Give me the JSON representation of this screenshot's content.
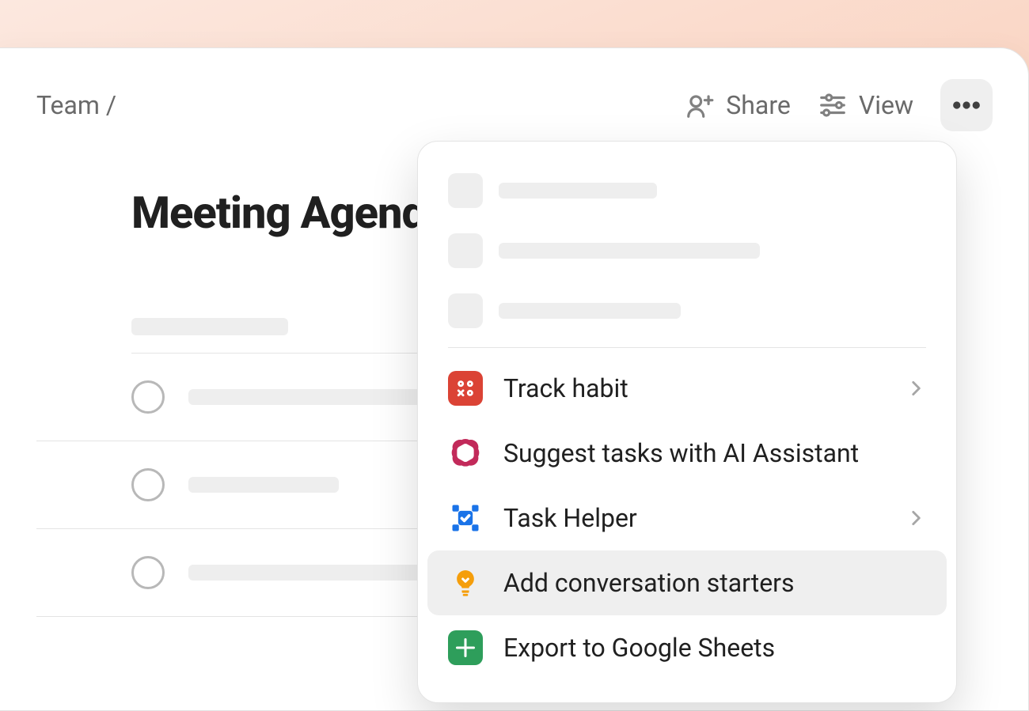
{
  "breadcrumb": {
    "parent": "Team",
    "separator": "/"
  },
  "toolbar": {
    "share_label": "Share",
    "view_label": "View"
  },
  "page_title": "Meeting Agenda",
  "menu": {
    "items": [
      {
        "id": "track-habit",
        "label": "Track habit",
        "icon": "dice-icon",
        "color": "#db4335",
        "chevron": true
      },
      {
        "id": "ai-assistant",
        "label": "Suggest tasks with AI Assistant",
        "icon": "openai-icon",
        "color": "#c22a5a",
        "chevron": false
      },
      {
        "id": "task-helper",
        "label": "Task Helper",
        "icon": "select-icon",
        "color": "#1a73e8",
        "chevron": true
      },
      {
        "id": "conversation-starters",
        "label": "Add conversation starters",
        "icon": "bulb-icon",
        "color": "#f59e0b",
        "chevron": false,
        "highlighted": true
      },
      {
        "id": "export-sheets",
        "label": "Export to Google Sheets",
        "icon": "sheets-icon",
        "color": "#2e9e5b",
        "chevron": false
      }
    ]
  }
}
